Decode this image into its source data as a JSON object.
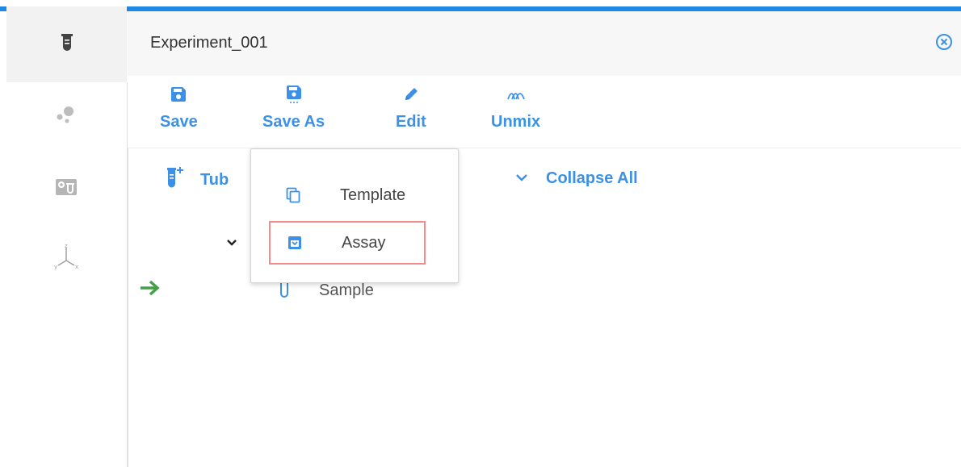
{
  "colors": {
    "accent": "#1e88e5",
    "link_blue": "#3c91e6",
    "green_arrow": "#43a047",
    "highlight_border": "#f28b8b"
  },
  "rail": {
    "items": [
      {
        "icon": "test-tube-icon"
      },
      {
        "icon": "dots-cluster-icon"
      },
      {
        "icon": "instrument-settings-icon"
      },
      {
        "icon": "xyz-axes-icon"
      }
    ]
  },
  "header": {
    "title": "Experiment_001",
    "close_icon": "close-circle-icon"
  },
  "toolbar": {
    "save_label": "Save",
    "save_as_label": "Save As",
    "edit_label": "Edit",
    "unmix_label": "Unmix"
  },
  "actions": {
    "tubes_label": "Tub",
    "collapse_all_label": "Collapse All"
  },
  "tree": {
    "sample_label": "Sample"
  },
  "save_as_menu": {
    "items": [
      {
        "label": "Template",
        "icon": "copy-icon"
      },
      {
        "label": "Assay",
        "icon": "assay-save-icon"
      }
    ]
  }
}
